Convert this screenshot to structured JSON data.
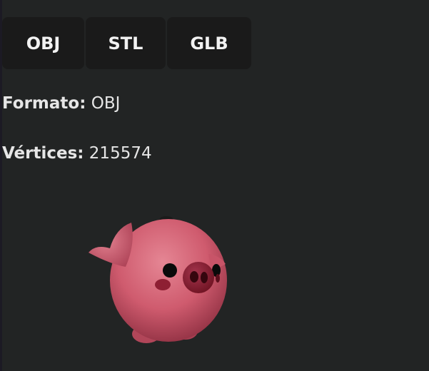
{
  "toolbar": {
    "buttons": [
      "OBJ",
      "STL",
      "GLB"
    ]
  },
  "info": {
    "format_label": "Formato:",
    "format_value": "OBJ",
    "vertices_label": "Vértices:",
    "vertices_value": "215574"
  },
  "viewer": {
    "model": "pig-model",
    "model_color": "#d45f72"
  },
  "colors": {
    "background": "#222424",
    "button_bg": "#1a1a1a",
    "text": "#e8e8e8"
  }
}
